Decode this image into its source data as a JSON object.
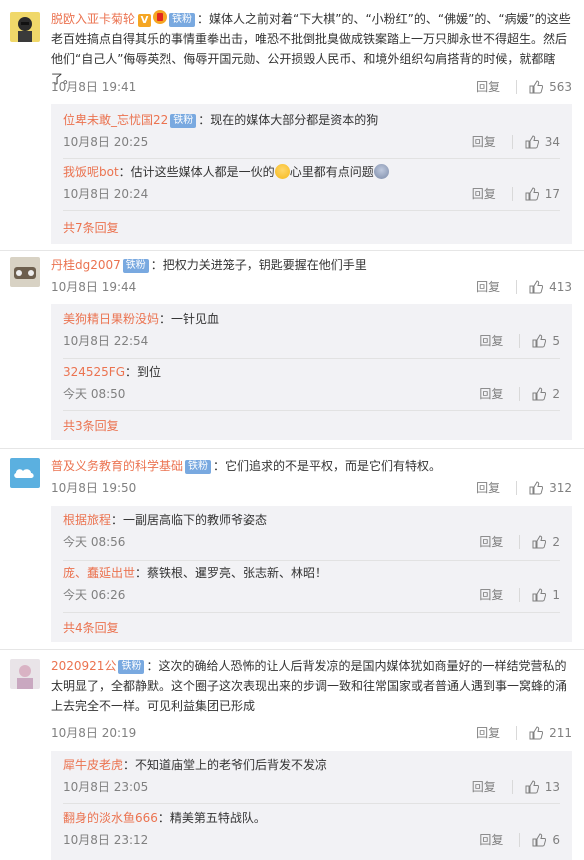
{
  "comments": [
    {
      "user": "脱欧入亚卡菊轮",
      "badge": "铁粉",
      "text": "：媒体人之前对着“下大棋”的、“小粉红”的、“佛媛”的、“病媛”的这些老百姓搞点自得其乐的事情重拳出击，唯恐不批倒批臭做成铁案踏上一万只脚永世不得超生。然后他们“自己人”侮辱英烈、侮辱开国元勋、公开损毁人民币、和境外组织勾肩搭背的时候，就都瞎了。",
      "time": "10月8日 19:41",
      "reply": "回复",
      "likes": "563",
      "replies": [
        {
          "user": "位卑未敢_忘忧国22",
          "badge": "铁粉",
          "text": "：现在的媒体大部分都是资本的狗",
          "time": "10月8日 20:25",
          "reply": "回复",
          "likes": "34"
        },
        {
          "user": "我饭呢bot",
          "badge": "",
          "text_a": "：估计这些媒体人都是一伙的",
          "text_b": "心里都有点问题",
          "time": "10月8日 20:24",
          "reply": "回复",
          "likes": "17"
        }
      ],
      "more": "共7条回复"
    },
    {
      "user": "丹桂dg2007",
      "badge": "铁粉",
      "text": "：把权力关进笼子，钥匙要握在他们手里",
      "time": "10月8日 19:44",
      "reply": "回复",
      "likes": "413",
      "replies": [
        {
          "user": "美狗精日果粉没妈",
          "badge": "",
          "text": "：一针见血",
          "time": "10月8日 22:54",
          "reply": "回复",
          "likes": "5"
        },
        {
          "user": "324525FG",
          "badge": "",
          "text": "：到位",
          "time": "今天 08:50",
          "reply": "回复",
          "likes": "2"
        }
      ],
      "more": "共3条回复"
    },
    {
      "user": "普及义务教育的科学基础",
      "badge": "铁粉",
      "text": "：它们追求的不是平权，而是它们有特权。",
      "time": "10月8日 19:50",
      "reply": "回复",
      "likes": "312",
      "replies": [
        {
          "user": "根据旅程",
          "badge": "",
          "text": "：一副居高临下的教师爷姿态",
          "time": "今天 08:56",
          "reply": "回复",
          "likes": "2"
        },
        {
          "user": "庞、蠢延出世",
          "badge": "",
          "text": "：蔡铁根、暹罗亮、张志新、林昭！",
          "time": "今天 06:26",
          "reply": "回复",
          "likes": "1"
        }
      ],
      "more": "共4条回复"
    },
    {
      "user": "2020921公",
      "badge": "铁粉",
      "text": "：这次的确给人恐怖的让人后背发凉的是国内媒体犹如商量好的一样结党营私的太明显了，全都静默。这个圈子这次表现出来的步调一致和往常国家或者普通人遇到事一窝蜂的涌上去完全不一样。可见利益集团已形成",
      "time": "10月8日 20:19",
      "reply": "回复",
      "likes": "211",
      "replies": [
        {
          "user": "犀牛皮老虎",
          "badge": "",
          "text": "：不知道庙堂上的老爷们后背发不发凉",
          "time": "10月8日 23:05",
          "reply": "回复",
          "likes": "13"
        },
        {
          "user": "翻身的淡水鱼666",
          "badge": "",
          "text": "：精美第五特战队。",
          "time": "10月8日 23:12",
          "reply": "回复",
          "likes": "6"
        }
      ],
      "more": ""
    }
  ],
  "colors": {
    "username": "#eb7350",
    "badge": "#79a9e0",
    "subbg": "#f2f2f5",
    "meta": "#808080"
  },
  "icons": {
    "like": "thumbs-up-icon"
  }
}
